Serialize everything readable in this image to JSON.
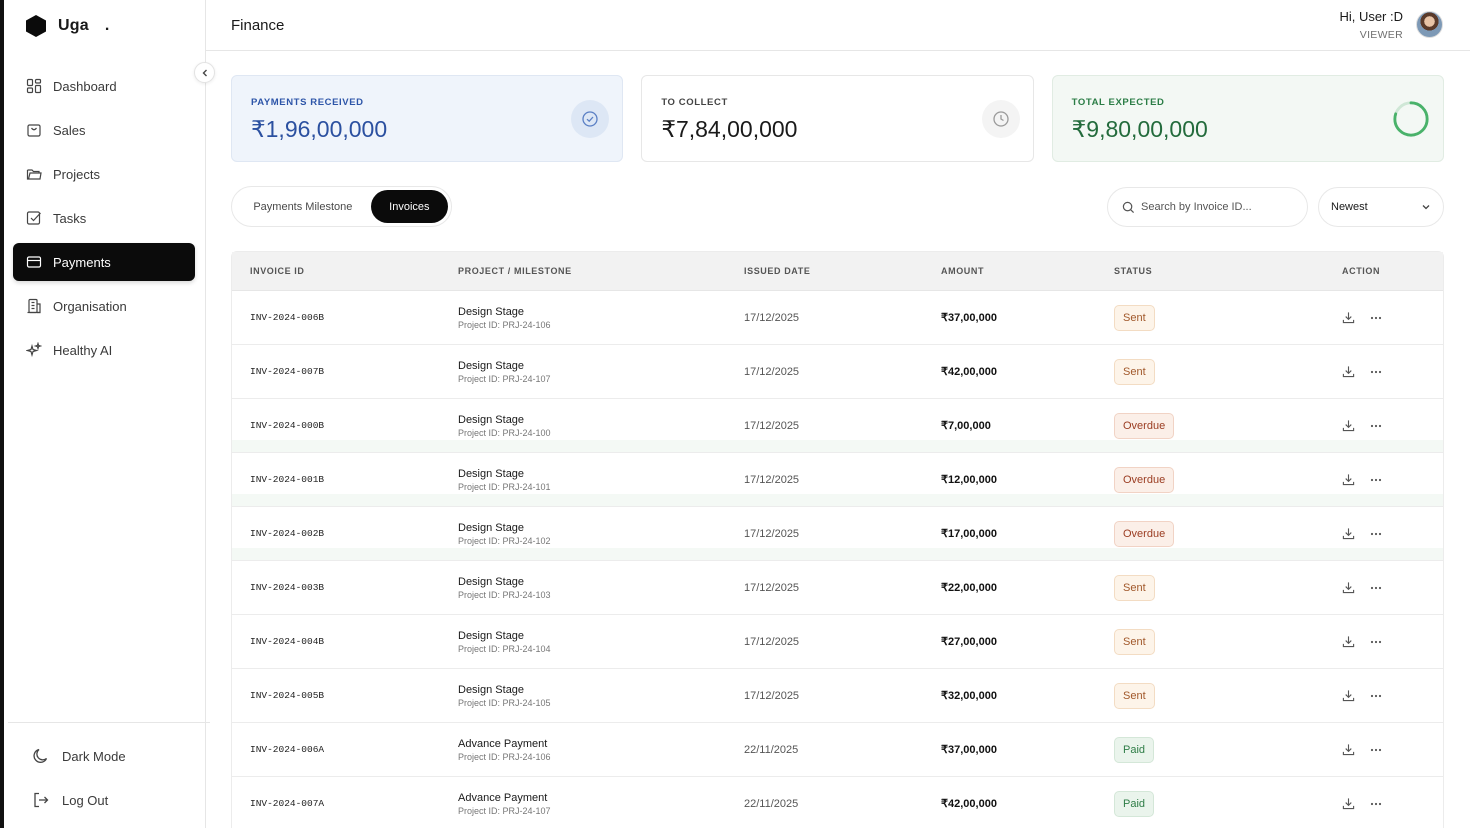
{
  "brand": {
    "name": "Uga",
    "dot": "."
  },
  "sidebar": {
    "items": [
      {
        "label": "Dashboard",
        "icon": "dashboard-icon"
      },
      {
        "label": "Sales",
        "icon": "shopping-bag-icon"
      },
      {
        "label": "Projects",
        "icon": "folder-icon"
      },
      {
        "label": "Tasks",
        "icon": "checkbox-icon"
      },
      {
        "label": "Payments",
        "icon": "credit-card-icon",
        "active": true
      },
      {
        "label": "Organisation",
        "icon": "building-icon"
      },
      {
        "label": "Healthy AI",
        "icon": "sparkles-icon"
      }
    ],
    "bottom": [
      {
        "label": "Dark Mode",
        "icon": "moon-icon"
      },
      {
        "label": "Log Out",
        "icon": "logout-icon"
      }
    ]
  },
  "header": {
    "title": "Finance",
    "user_greeting": "Hi, User :D",
    "user_role": "VIEWER"
  },
  "cards": [
    {
      "label": "PAYMENTS RECEIVED",
      "value": "₹1,96,00,000",
      "icon": "check-circle-icon",
      "accent": "#2b50a0"
    },
    {
      "label": "TO COLLECT",
      "value": "₹7,84,00,000",
      "icon": "clock-icon",
      "accent": "#1a1a1a"
    },
    {
      "label": "TOTAL EXPECTED",
      "value": "₹9,80,00,000",
      "icon": "progress-ring-icon",
      "accent": "#236b3c",
      "progress": 0.8
    }
  ],
  "tabs": [
    {
      "label": "Payments Milestone",
      "active": false
    },
    {
      "label": "Invoices",
      "active": true
    }
  ],
  "search": {
    "placeholder": "Search by Invoice ID..."
  },
  "sort": {
    "selected": "Newest"
  },
  "table": {
    "columns": [
      "INVOICE ID",
      "PROJECT / MILESTONE",
      "ISSUED DATE",
      "AMOUNT",
      "STATUS",
      "ACTION"
    ],
    "rows": [
      {
        "id": "INV-2024-006B",
        "milestone": "Design Stage",
        "project": "Project ID: PRJ-24-106",
        "date": "17/12/2025",
        "amount": "₹37,00,000",
        "status": "Sent"
      },
      {
        "id": "INV-2024-007B",
        "milestone": "Design Stage",
        "project": "Project ID: PRJ-24-107",
        "date": "17/12/2025",
        "amount": "₹42,00,000",
        "status": "Sent"
      },
      {
        "id": "INV-2024-000B",
        "milestone": "Design Stage",
        "project": "Project ID: PRJ-24-100",
        "date": "17/12/2025",
        "amount": "₹7,00,000",
        "status": "Overdue"
      },
      {
        "id": "INV-2024-001B",
        "milestone": "Design Stage",
        "project": "Project ID: PRJ-24-101",
        "date": "17/12/2025",
        "amount": "₹12,00,000",
        "status": "Overdue"
      },
      {
        "id": "INV-2024-002B",
        "milestone": "Design Stage",
        "project": "Project ID: PRJ-24-102",
        "date": "17/12/2025",
        "amount": "₹17,00,000",
        "status": "Overdue"
      },
      {
        "id": "INV-2024-003B",
        "milestone": "Design Stage",
        "project": "Project ID: PRJ-24-103",
        "date": "17/12/2025",
        "amount": "₹22,00,000",
        "status": "Sent"
      },
      {
        "id": "INV-2024-004B",
        "milestone": "Design Stage",
        "project": "Project ID: PRJ-24-104",
        "date": "17/12/2025",
        "amount": "₹27,00,000",
        "status": "Sent"
      },
      {
        "id": "INV-2024-005B",
        "milestone": "Design Stage",
        "project": "Project ID: PRJ-24-105",
        "date": "17/12/2025",
        "amount": "₹32,00,000",
        "status": "Sent"
      },
      {
        "id": "INV-2024-006A",
        "milestone": "Advance Payment",
        "project": "Project ID: PRJ-24-106",
        "date": "22/11/2025",
        "amount": "₹37,00,000",
        "status": "Paid"
      },
      {
        "id": "INV-2024-007A",
        "milestone": "Advance Payment",
        "project": "Project ID: PRJ-24-107",
        "date": "22/11/2025",
        "amount": "₹42,00,000",
        "status": "Paid"
      }
    ]
  }
}
